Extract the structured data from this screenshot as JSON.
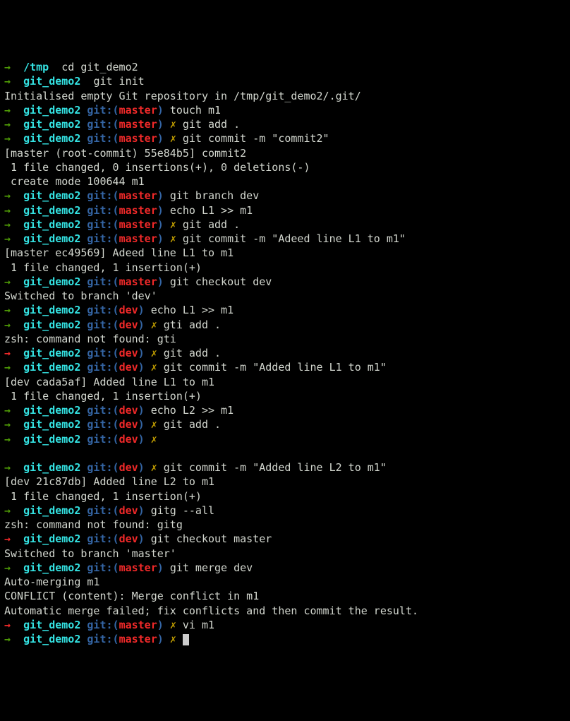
{
  "arrows": {
    "r": "→",
    "g": "→"
  },
  "lines": [
    {
      "t": "prompt-basic",
      "arrow": "g",
      "dir": "/tmp",
      "cmd": "cd git_demo2"
    },
    {
      "t": "prompt-basic",
      "arrow": "g",
      "dir": "git_demo2",
      "cmd": "git init"
    },
    {
      "t": "out",
      "text": "Initialised empty Git repository in /tmp/git_demo2/.git/"
    },
    {
      "t": "prompt-git",
      "arrow": "g",
      "dir": "git_demo2",
      "branch": "master",
      "dirty": false,
      "cmd": "touch m1"
    },
    {
      "t": "prompt-git",
      "arrow": "g",
      "dir": "git_demo2",
      "branch": "master",
      "dirty": true,
      "cmd": "git add ."
    },
    {
      "t": "prompt-git",
      "arrow": "g",
      "dir": "git_demo2",
      "branch": "master",
      "dirty": true,
      "cmd": "git commit -m \"commit2\""
    },
    {
      "t": "out",
      "text": "[master (root-commit) 55e84b5] commit2"
    },
    {
      "t": "out",
      "text": " 1 file changed, 0 insertions(+), 0 deletions(-)"
    },
    {
      "t": "out",
      "text": " create mode 100644 m1"
    },
    {
      "t": "prompt-git",
      "arrow": "g",
      "dir": "git_demo2",
      "branch": "master",
      "dirty": false,
      "cmd": "git branch dev"
    },
    {
      "t": "prompt-git",
      "arrow": "g",
      "dir": "git_demo2",
      "branch": "master",
      "dirty": false,
      "cmd": "echo L1 >> m1"
    },
    {
      "t": "prompt-git",
      "arrow": "g",
      "dir": "git_demo2",
      "branch": "master",
      "dirty": true,
      "cmd": "git add ."
    },
    {
      "t": "prompt-git",
      "arrow": "g",
      "dir": "git_demo2",
      "branch": "master",
      "dirty": true,
      "cmd": "git commit -m \"Adeed line L1 to m1\""
    },
    {
      "t": "out",
      "text": "[master ec49569] Adeed line L1 to m1"
    },
    {
      "t": "out",
      "text": " 1 file changed, 1 insertion(+)"
    },
    {
      "t": "prompt-git",
      "arrow": "g",
      "dir": "git_demo2",
      "branch": "master",
      "dirty": false,
      "cmd": "git checkout dev"
    },
    {
      "t": "out",
      "text": "Switched to branch 'dev'"
    },
    {
      "t": "prompt-git",
      "arrow": "g",
      "dir": "git_demo2",
      "branch": "dev",
      "dirty": false,
      "cmd": "echo L1 >> m1"
    },
    {
      "t": "prompt-git",
      "arrow": "g",
      "dir": "git_demo2",
      "branch": "dev",
      "dirty": true,
      "cmd": "gti add ."
    },
    {
      "t": "out",
      "text": "zsh: command not found: gti"
    },
    {
      "t": "prompt-git",
      "arrow": "r",
      "dir": "git_demo2",
      "branch": "dev",
      "dirty": true,
      "cmd": "git add ."
    },
    {
      "t": "prompt-git",
      "arrow": "g",
      "dir": "git_demo2",
      "branch": "dev",
      "dirty": true,
      "cmd": "git commit -m \"Added line L1 to m1\""
    },
    {
      "t": "out",
      "text": "[dev cada5af] Added line L1 to m1"
    },
    {
      "t": "out",
      "text": " 1 file changed, 1 insertion(+)"
    },
    {
      "t": "prompt-git",
      "arrow": "g",
      "dir": "git_demo2",
      "branch": "dev",
      "dirty": false,
      "cmd": "echo L2 >> m1"
    },
    {
      "t": "prompt-git",
      "arrow": "g",
      "dir": "git_demo2",
      "branch": "dev",
      "dirty": true,
      "cmd": "git add ."
    },
    {
      "t": "prompt-git",
      "arrow": "g",
      "dir": "git_demo2",
      "branch": "dev",
      "dirty": true,
      "cmd": ""
    },
    {
      "t": "blank"
    },
    {
      "t": "prompt-git",
      "arrow": "g",
      "dir": "git_demo2",
      "branch": "dev",
      "dirty": true,
      "cmd": "git commit -m \"Added line L2 to m1\""
    },
    {
      "t": "out",
      "text": "[dev 21c87db] Added line L2 to m1"
    },
    {
      "t": "out",
      "text": " 1 file changed, 1 insertion(+)"
    },
    {
      "t": "prompt-git",
      "arrow": "g",
      "dir": "git_demo2",
      "branch": "dev",
      "dirty": false,
      "cmd": "gitg --all"
    },
    {
      "t": "out",
      "text": "zsh: command not found: gitg"
    },
    {
      "t": "prompt-git",
      "arrow": "r",
      "dir": "git_demo2",
      "branch": "dev",
      "dirty": false,
      "cmd": "git checkout master"
    },
    {
      "t": "out",
      "text": "Switched to branch 'master'"
    },
    {
      "t": "prompt-git",
      "arrow": "g",
      "dir": "git_demo2",
      "branch": "master",
      "dirty": false,
      "cmd": "git merge dev"
    },
    {
      "t": "out",
      "text": "Auto-merging m1"
    },
    {
      "t": "out",
      "text": "CONFLICT (content): Merge conflict in m1"
    },
    {
      "t": "out",
      "text": "Automatic merge failed; fix conflicts and then commit the result."
    },
    {
      "t": "prompt-git",
      "arrow": "r",
      "dir": "git_demo2",
      "branch": "master",
      "dirty": true,
      "cmd": "vi m1"
    },
    {
      "t": "prompt-git",
      "arrow": "g",
      "dir": "git_demo2",
      "branch": "master",
      "dirty": true,
      "cmd": "",
      "cursor": true
    }
  ],
  "tokens": {
    "gitlabel": "git:",
    "lparen": "(",
    "rparen": ")",
    "dirty": "✗"
  }
}
